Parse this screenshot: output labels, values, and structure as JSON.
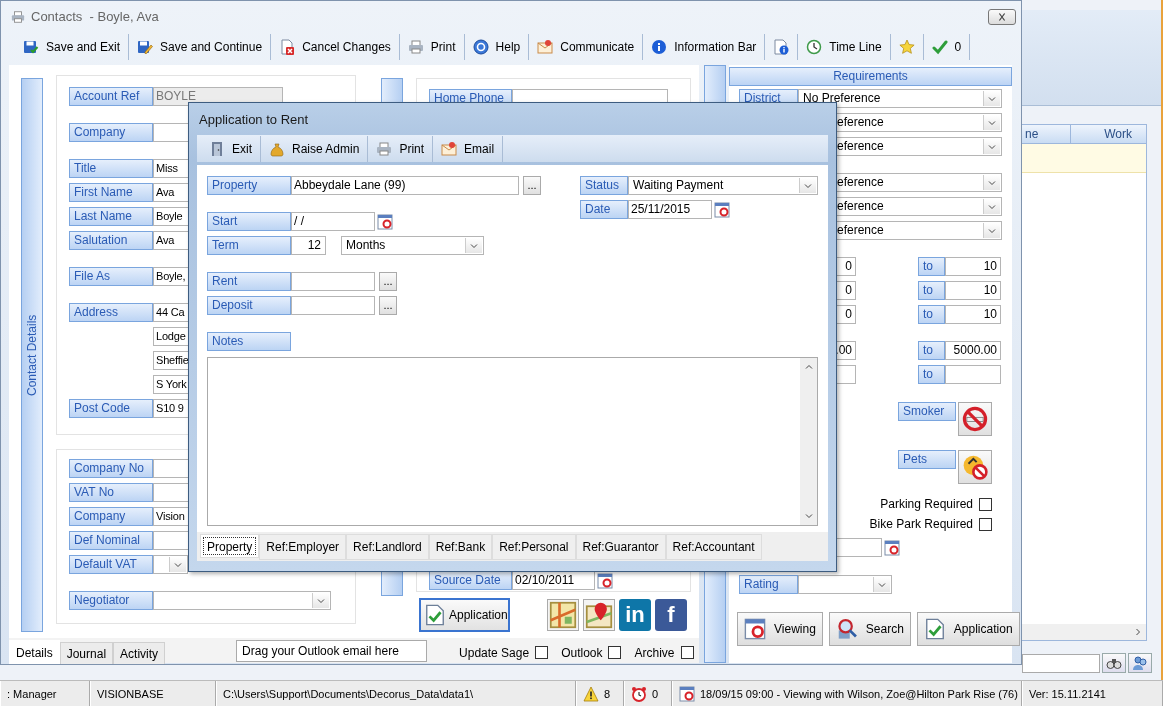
{
  "background_app": {
    "columns": [
      "ne",
      "Work"
    ]
  },
  "contacts_window": {
    "title": "Contacts  - Boyle, Ava",
    "toolbar": [
      {
        "kind": "button",
        "label": "Save and Exit"
      },
      {
        "kind": "button",
        "label": "Save and Continue"
      },
      {
        "kind": "button",
        "label": "Cancel Changes"
      },
      {
        "kind": "button",
        "label": "Print"
      },
      {
        "kind": "button",
        "label": "Help"
      },
      {
        "kind": "button",
        "label": "Communicate"
      },
      {
        "kind": "button",
        "label": "Information Bar"
      },
      {
        "kind": "icon_button"
      },
      {
        "kind": "button",
        "label": "Time Line"
      },
      {
        "kind": "icon_button"
      },
      {
        "kind": "button",
        "label": "0"
      }
    ],
    "side_tab": "Contact Details",
    "contact_sections": [
      [
        [
          {
            "kind": "readonly",
            "label": "Account Ref",
            "value": "BOYLE"
          }
        ],
        [
          {
            "kind": "field",
            "label": "Company"
          }
        ],
        [
          {
            "kind": "field",
            "label": "Title",
            "value": "Miss"
          },
          {
            "kind": "field",
            "label": "First Name",
            "value": "Ava"
          },
          {
            "kind": "field",
            "label": "Last Name",
            "value": "Boyle"
          },
          {
            "kind": "field",
            "label": "Salutation",
            "value": "Ava"
          }
        ],
        [
          {
            "kind": "field",
            "label": "File As",
            "value": "Boyle,"
          }
        ],
        [
          {
            "kind": "field",
            "label": "Address",
            "value": "44 Ca"
          },
          {
            "kind": "line",
            "value": "Lodge"
          },
          {
            "kind": "line",
            "value": "Sheffie"
          },
          {
            "kind": "line",
            "value": "S York"
          },
          {
            "kind": "field",
            "label": "Post Code",
            "value": "S10 9"
          }
        ]
      ],
      [
        [
          {
            "kind": "field",
            "label": "Company No"
          },
          {
            "kind": "field",
            "label": "VAT No"
          },
          {
            "kind": "field",
            "label": "Company",
            "value": "Vision"
          },
          {
            "kind": "field",
            "label": "Def Nominal"
          },
          {
            "kind": "small_dropdown",
            "label": "Default VAT"
          }
        ],
        [
          {
            "kind": "dropdown",
            "label": "Negotiator"
          }
        ]
      ]
    ],
    "home_phone": {
      "label": "Home Phone"
    },
    "source_date": {
      "label": "Source Date",
      "value": "02/10/2011"
    },
    "application_button": "Application",
    "social_links": [
      {
        "text": "in",
        "color": "#0e76a8"
      },
      {
        "text": "f",
        "color": "#3b5998"
      }
    ],
    "bottom_tabs": [
      {
        "label": "Details",
        "selected": true
      },
      {
        "label": "Journal",
        "selected": false
      },
      {
        "label": "Activity",
        "selected": false
      }
    ],
    "outlook_drop": "Drag your Outlook email here",
    "options": [
      {
        "label": "Update Sage",
        "checked": false
      },
      {
        "label": "Outlook",
        "checked": false
      },
      {
        "label": "Archive",
        "checked": false
      }
    ],
    "requirements": {
      "title": "Requirements",
      "preference_groups": [
        [
          {
            "label": "District",
            "value": "No Preference"
          },
          {
            "value": "eference"
          },
          {
            "value": "eference"
          }
        ],
        [
          {
            "value": "eference"
          },
          {
            "value": "eference"
          },
          {
            "value": "eference"
          }
        ]
      ],
      "range_groups": [
        [
          {
            "from": "0",
            "to_label": "to",
            "to": "10"
          },
          {
            "from": "0",
            "to_label": "to",
            "to": "10"
          },
          {
            "from": "0",
            "to_label": "to",
            "to": "10"
          }
        ],
        [
          {
            "from": ".00",
            "to_label": "to",
            "to": "5000.00"
          },
          {
            "to_label": "to"
          }
        ]
      ],
      "toggles": [
        {
          "label": "Smoker"
        },
        {
          "label": "Pets"
        }
      ],
      "checks": [
        {
          "label": "Parking Required",
          "checked": false
        },
        {
          "label": "Bike Park Required",
          "checked": false
        }
      ],
      "rating": {
        "label": "Rating"
      },
      "buttons": [
        {
          "label": "Viewing"
        },
        {
          "label": "Search"
        },
        {
          "label": "Application"
        }
      ]
    }
  },
  "dialog": {
    "title": "Application to Rent",
    "toolbar": [
      {
        "label": "Exit"
      },
      {
        "label": "Raise Admin"
      },
      {
        "label": "Print"
      },
      {
        "label": "Email"
      }
    ],
    "left_groups": [
      [
        {
          "kind": "lookup",
          "label": "Property",
          "value": "Abbeydale Lane (99)",
          "button": "..."
        }
      ],
      [
        {
          "kind": "date",
          "label": "Start",
          "value": "/ /"
        },
        {
          "kind": "term",
          "label": "Term",
          "value": "12",
          "unit": "Months"
        }
      ],
      [
        {
          "kind": "lookup",
          "label": "Rent",
          "button": "..."
        },
        {
          "kind": "lookup",
          "label": "Deposit",
          "button": "..."
        }
      ],
      [
        {
          "kind": "label",
          "label": "Notes"
        }
      ]
    ],
    "right_rows": [
      {
        "kind": "dropdown",
        "label": "Status",
        "value": "Waiting Payment"
      },
      {
        "kind": "date",
        "label": "Date",
        "value": "25/11/2015"
      }
    ],
    "tabs": [
      {
        "label": "Property",
        "selected": true
      },
      {
        "label": "Ref:Employer",
        "selected": false
      },
      {
        "label": "Ref:Landlord",
        "selected": false
      },
      {
        "label": "Ref:Bank",
        "selected": false
      },
      {
        "label": "Ref:Personal",
        "selected": false
      },
      {
        "label": "Ref:Guarantor",
        "selected": false
      },
      {
        "label": "Ref:Accountant",
        "selected": false
      }
    ]
  },
  "status_bar": [
    {
      "kind": "text",
      "text": ": Manager"
    },
    {
      "kind": "text",
      "text": "VISIONBASE"
    },
    {
      "kind": "text",
      "text": "C:\\Users\\Support\\Documents\\Decorus_Data\\data1\\"
    },
    {
      "kind": "warning",
      "text": "8"
    },
    {
      "kind": "alarm",
      "text": "0"
    },
    {
      "kind": "event",
      "text": "18/09/15 09:00 - Viewing with Wilson, Zoe@Hilton Park Rise (76)"
    },
    {
      "kind": "text",
      "text": "Ver: 15.11.2141"
    }
  ]
}
